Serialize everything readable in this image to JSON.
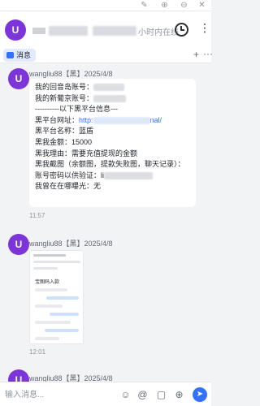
{
  "header": {
    "avatar_letter": "U",
    "status": "小时内在线"
  },
  "tabs": {
    "messages_label": "消息",
    "plus": "+",
    "more": "···"
  },
  "messages": [
    {
      "avatar_letter": "U",
      "sender": "wangliu88【黑】2025/4/8",
      "time": "11:57",
      "lines": [
        "我的回音岛账号：",
        "我的新葡京账号：",
        "----------以下黑平台信息---",
        "黑平台网址：",
        "黑平台名称：蓝盾",
        "黑我金额：15000",
        "黑我理由：需要充值提现的金额",
        "黑我截图（余额图，提款失败图，聊天记录）：",
        "账号密码以供验证：li",
        "我曾在在哪曝光：无"
      ],
      "link_prefix": "http:",
      "link_suffix": "nal/"
    },
    {
      "avatar_letter": "U",
      "sender": "wangliu88【黑】2025/4/8",
      "time": "12:01",
      "thumbnail_text": "宝图码入款"
    },
    {
      "avatar_letter": "U",
      "sender": "wangliu88【黑】2025/4/8"
    }
  ],
  "composer": {
    "placeholder": "输入消息..."
  }
}
